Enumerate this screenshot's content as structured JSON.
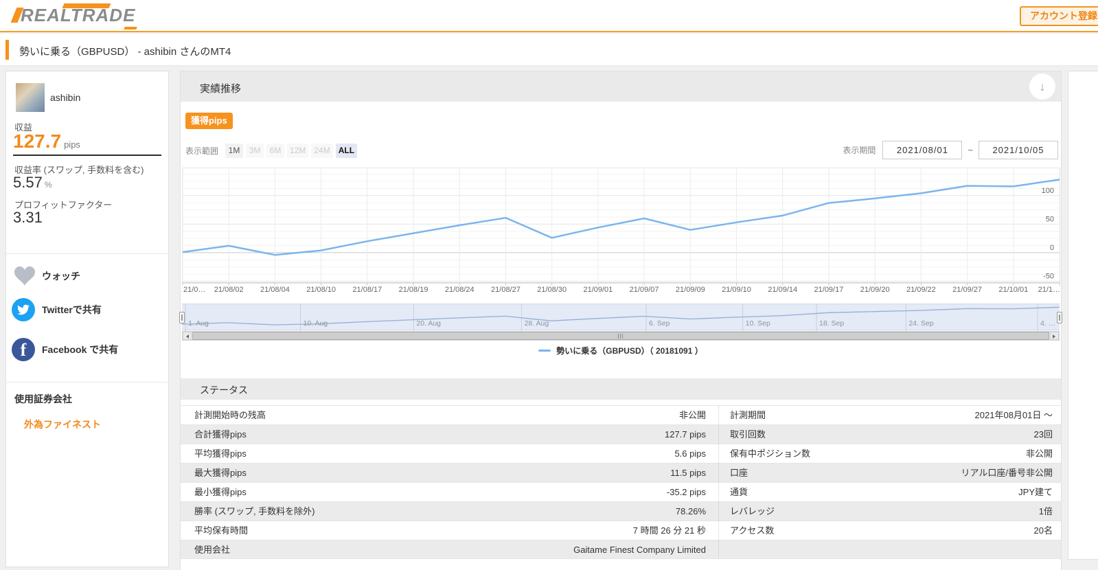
{
  "header": {
    "logo_part1": "REAL",
    "logo_part2": "TRADE",
    "register_button": "アカウント登録"
  },
  "breadcrumb": {
    "title": "勢いに乗る（GBPUSD） - ashibin さんのMT4"
  },
  "sidebar": {
    "username": "ashibin",
    "profit_label": "収益",
    "profit_value": "127.7",
    "profit_unit": "pips",
    "return_label": "収益率 (スワップ, 手数料を含む)",
    "return_value": "5.57",
    "return_unit": "%",
    "pf_label": "プロフィットファクター",
    "pf_value": "3.31",
    "watch_label": "ウォッチ",
    "twitter_label": "Twitterで共有",
    "facebook_label": "Facebook で共有",
    "facebook_glyph": "f",
    "broker_section_label": "使用証券会社",
    "broker_name": "外為ファイネスト"
  },
  "panel": {
    "title": "実績推移",
    "download_icon": "↓",
    "badge": "獲得pips",
    "range_label": "表示範囲",
    "range_buttons": [
      {
        "label": "1M",
        "state": "normal"
      },
      {
        "label": "3M",
        "state": "disabled"
      },
      {
        "label": "6M",
        "state": "disabled"
      },
      {
        "label": "12M",
        "state": "disabled"
      },
      {
        "label": "24M",
        "state": "disabled"
      },
      {
        "label": "ALL",
        "state": "active"
      }
    ],
    "period_label": "表示期間",
    "period_from": "2021/08/01",
    "period_separator": "~",
    "period_to": "2021/10/05"
  },
  "chart_data": {
    "type": "line",
    "title": "実績推移",
    "ylabel": "獲得pips",
    "x_labels": [
      "21/0…",
      "21/08/02",
      "21/08/04",
      "21/08/10",
      "21/08/17",
      "21/08/19",
      "21/08/24",
      "21/08/27",
      "21/08/30",
      "21/09/01",
      "21/09/07",
      "21/09/09",
      "21/09/10",
      "21/09/14",
      "21/09/17",
      "21/09/20",
      "21/09/22",
      "21/09/27",
      "21/10/01",
      "21/1…"
    ],
    "values": [
      1,
      12,
      -4,
      4,
      20,
      34,
      48,
      61,
      26,
      44,
      60,
      40,
      53,
      65,
      87,
      95,
      104,
      117,
      116,
      128
    ],
    "y_ticks": [
      -50,
      0,
      50,
      100
    ],
    "ylim": [
      -53,
      149
    ],
    "grid": true,
    "legend_position": "bottom-center",
    "legend": "勢いに乗る（GBPUSD）（ 20181091 ）",
    "line_color": "#7cb5ec",
    "navigator_labels": [
      "1. Aug",
      "10. Aug",
      "20. Aug",
      "28. Aug",
      "6. Sep",
      "10. Sep",
      "18. Sep",
      "24. Sep",
      "4. …"
    ],
    "navigator_fractions": [
      0.004,
      0.135,
      0.264,
      0.387,
      0.529,
      0.639,
      0.723,
      0.825,
      0.975
    ]
  },
  "status": {
    "title": "ステータス",
    "rows": [
      {
        "l1": "計測開始時の残高",
        "v1": "非公開",
        "l2": "計測期間",
        "v2": "2021年08月01日 ～"
      },
      {
        "l1": "合計獲得pips",
        "v1": "127.7 pips",
        "l2": "取引回数",
        "v2": "23回"
      },
      {
        "l1": "平均獲得pips",
        "v1": "5.6 pips",
        "l2": "保有中ポジション数",
        "v2": "非公開"
      },
      {
        "l1": "最大獲得pips",
        "v1": "11.5 pips",
        "l2": "口座",
        "v2": "リアル口座/番号非公開"
      },
      {
        "l1": "最小獲得pips",
        "v1": "-35.2 pips",
        "l2": "通貨",
        "v2": "JPY建て"
      },
      {
        "l1": "勝率 (スワップ, 手数料を除外)",
        "v1": "78.26%",
        "l2": "レバレッジ",
        "v2": "1倍"
      },
      {
        "l1": "平均保有時間",
        "v1": "7 時間 26 分 21 秒",
        "l2": "アクセス数",
        "v2": "20名"
      },
      {
        "l1": "使用会社",
        "v1": "Gaitame Finest Company Limited",
        "l2": "",
        "v2": ""
      }
    ]
  }
}
